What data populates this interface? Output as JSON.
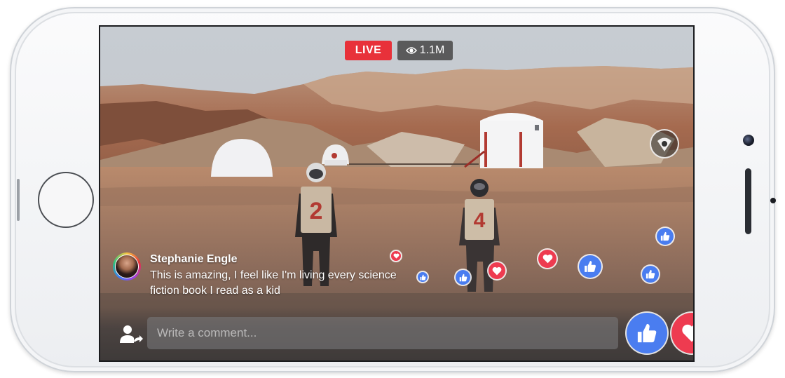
{
  "stream": {
    "live_label": "LIVE",
    "viewer_count": "1.1M"
  },
  "comment": {
    "author": "Stephanie Engle",
    "text": "This is amazing, I feel like I'm living every science fiction book I read as a kid"
  },
  "composer": {
    "placeholder": "Write a comment..."
  },
  "scene": {
    "astronaut_numbers": [
      "2",
      "4"
    ]
  },
  "colors": {
    "live_red": "#e8313a",
    "like_blue": "#4a7df0",
    "love_red": "#ee3b50"
  },
  "icons": {
    "viewers": "eye-icon",
    "compass": "360-compass-icon",
    "share": "share-user-icon",
    "like": "thumbs-up-icon",
    "love": "heart-icon"
  }
}
